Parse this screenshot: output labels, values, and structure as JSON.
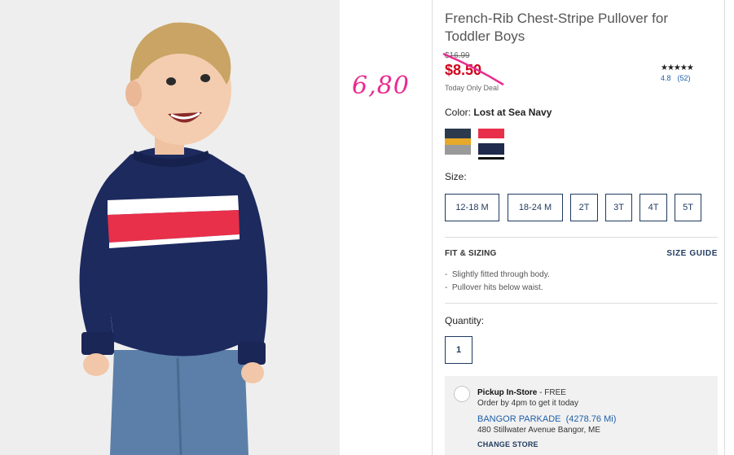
{
  "annotation": {
    "text": "6,80"
  },
  "product": {
    "title": "French-Rib Chest-Stripe Pullover for Toddler Boys",
    "original_price": "$16.99",
    "sale_price": "$8.50",
    "deal_label": "Today Only Deal"
  },
  "rating": {
    "stars": "★★★★★",
    "score": "4.8",
    "count": "(52)"
  },
  "color": {
    "label": "Color:",
    "selected": "Lost at Sea Navy",
    "swatches": [
      {
        "name": "navy-yellow-grey",
        "colors": [
          "#2c3a4e",
          "#e6a92a",
          "#9a9a9a"
        ]
      },
      {
        "name": "lost-at-sea-navy",
        "colors": [
          "#e8304a",
          "#ffffff",
          "#1f2a4d"
        ]
      }
    ]
  },
  "size": {
    "label": "Size:",
    "options": [
      "12-18 M",
      "18-24 M",
      "2T",
      "3T",
      "4T",
      "5T"
    ]
  },
  "fit": {
    "title": "FIT & SIZING",
    "guide_label": "SIZE GUIDE",
    "items": [
      "Slightly fitted through body.",
      "Pullover hits below waist."
    ]
  },
  "quantity": {
    "label": "Quantity:",
    "value": "1"
  },
  "pickup": {
    "title": "Pickup In-Store",
    "free": " - FREE",
    "order_by": "Order by 4pm to get it today",
    "store_name": "BANGOR PARKADE",
    "distance": "(4278.76 Mi)",
    "address": "480 Stillwater Avenue Bangor, ME",
    "change_label": "CHANGE STORE"
  },
  "colors": {
    "sale": "#d0021b",
    "link": "#1f5fa7",
    "navy": "#1f3a5f",
    "annotation": "#ea2a8f"
  }
}
